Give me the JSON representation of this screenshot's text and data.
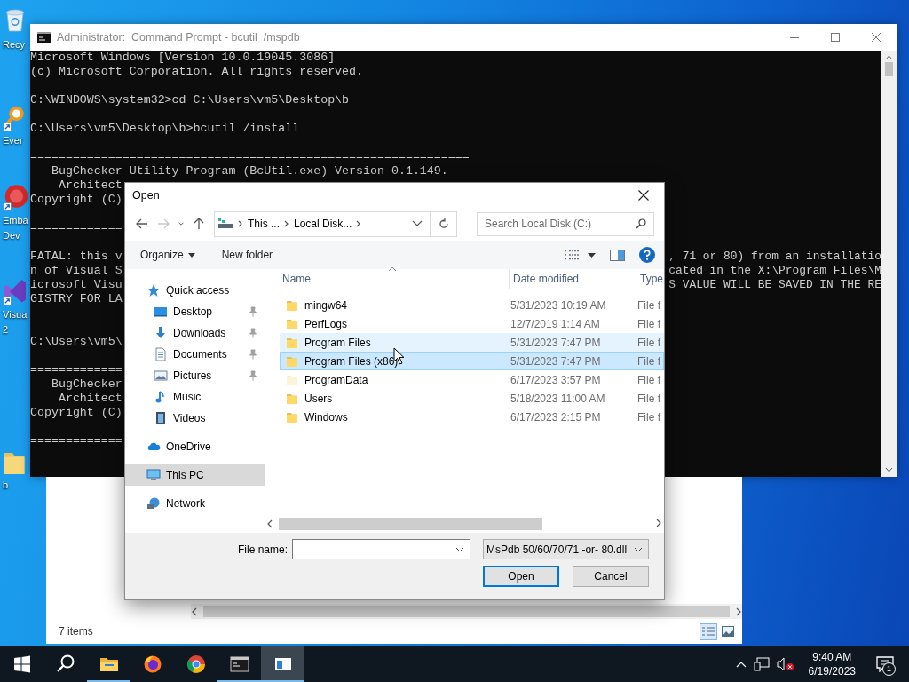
{
  "desktop_icons": [
    {
      "kind": "bin",
      "shortcut": false,
      "label_lines": [
        "Recy"
      ]
    },
    {
      "kind": "search",
      "shortcut": true,
      "label_lines": [
        "Ever"
      ]
    },
    {
      "kind": "embarcadero",
      "shortcut": true,
      "label_lines": [
        "Emba",
        "Dev"
      ]
    },
    {
      "kind": "studio",
      "shortcut": true,
      "label_lines": [
        "Visua",
        "2"
      ]
    },
    {
      "kind": "folder",
      "shortcut": false,
      "label_lines": [
        "b"
      ]
    }
  ],
  "console": {
    "title": "Administrator:  Command Prompt - bcutil  /mspdb",
    "lines": [
      {
        "kind": "text",
        "text": "Microsoft Windows [Version 10.0.19045.3086]"
      },
      {
        "kind": "text",
        "text": "(c) Microsoft Corporation. All rights reserved."
      },
      {
        "kind": "blank"
      },
      {
        "kind": "text",
        "text": "C:\\WINDOWS\\system32>cd C:\\Users\\vm5\\Desktop\\b"
      },
      {
        "kind": "blank"
      },
      {
        "kind": "text",
        "text": "C:\\Users\\vm5\\Desktop\\b>bcutil /install"
      },
      {
        "kind": "blank"
      },
      {
        "kind": "text",
        "text": "=============================================================="
      },
      {
        "kind": "text",
        "text": "   BugChecker Utility Program (BcUtil.exe) Version 0.1.149."
      },
      {
        "kind": "text",
        "text": "    Architect"
      },
      {
        "kind": "text",
        "text": "Copyright (C)"
      },
      {
        "kind": "blank"
      },
      {
        "kind": "text",
        "text": "============="
      },
      {
        "kind": "blank"
      },
      {
        "kind": "text",
        "text": "FATAL: this v",
        "tail": ", 71 or 80) from an installatio"
      },
      {
        "kind": "text",
        "text": "n of Visual S",
        "tail": "cated in the X:\\Program Files\\M"
      },
      {
        "kind": "text",
        "text": "icrosoft Visu",
        "tail": "S VALUE WILL BE SAVED IN THE RE"
      },
      {
        "kind": "text",
        "text": "GISTRY FOR LA"
      },
      {
        "kind": "blank"
      },
      {
        "kind": "blank"
      },
      {
        "kind": "text",
        "text": "C:\\Users\\vm5\\"
      },
      {
        "kind": "blank"
      },
      {
        "kind": "text",
        "text": "============="
      },
      {
        "kind": "text",
        "text": "   BugChecker"
      },
      {
        "kind": "text",
        "text": "    Architect"
      },
      {
        "kind": "text",
        "text": "Copyright (C)"
      },
      {
        "kind": "blank"
      },
      {
        "kind": "text",
        "text": "============="
      }
    ]
  },
  "explorer": {
    "status": "7 items"
  },
  "dialog": {
    "title": "Open",
    "breadcrumb": [
      "This ...",
      "Local Disk..."
    ],
    "search": {
      "placeholder": "Search Local Disk (C:)"
    },
    "toolbar": {
      "organize": "Organize",
      "new_folder": "New folder"
    },
    "nav": [
      {
        "kind": "star",
        "label": "Quick access",
        "pinned": false,
        "selected": false,
        "children": [
          {
            "kind": "desktop",
            "label": "Desktop",
            "pinned": true,
            "selected": false
          },
          {
            "kind": "download",
            "label": "Downloads",
            "pinned": true,
            "selected": false
          },
          {
            "kind": "documents",
            "label": "Documents",
            "pinned": true,
            "selected": false
          },
          {
            "kind": "pictures",
            "label": "Pictures",
            "pinned": true,
            "selected": false
          },
          {
            "kind": "music",
            "label": "Music",
            "pinned": false,
            "selected": false
          },
          {
            "kind": "videos",
            "label": "Videos",
            "pinned": false,
            "selected": false
          }
        ]
      },
      {
        "kind": "cloud",
        "label": "OneDrive",
        "pinned": false,
        "selected": false
      },
      {
        "kind": "pc",
        "label": "This PC",
        "pinned": false,
        "selected": true
      },
      {
        "kind": "network",
        "label": "Network",
        "pinned": false,
        "selected": false
      }
    ],
    "columns": [
      "Name",
      "Date modified",
      "Type"
    ],
    "rows": [
      {
        "name": "mingw64",
        "date": "5/31/2023 10:19 AM",
        "type": "File f",
        "hidden": false,
        "hovered": false,
        "selected": false
      },
      {
        "name": "PerfLogs",
        "date": "12/7/2019 1:14 AM",
        "type": "File f",
        "hidden": false,
        "hovered": false,
        "selected": false
      },
      {
        "name": "Program Files",
        "date": "5/31/2023 7:47 PM",
        "type": "File f",
        "hidden": false,
        "hovered": true,
        "selected": false
      },
      {
        "name": "Program Files (x86)",
        "date": "5/31/2023 7:47 PM",
        "type": "File f",
        "hidden": false,
        "hovered": false,
        "selected": true
      },
      {
        "name": "ProgramData",
        "date": "6/17/2023 3:57 PM",
        "type": "File f",
        "hidden": true,
        "hovered": false,
        "selected": false
      },
      {
        "name": "Users",
        "date": "5/18/2023 11:00 AM",
        "type": "File f",
        "hidden": false,
        "hovered": false,
        "selected": false
      },
      {
        "name": "Windows",
        "date": "6/17/2023 2:15 PM",
        "type": "File f",
        "hidden": false,
        "hovered": false,
        "selected": false
      }
    ],
    "file_name": {
      "label": "File name:"
    },
    "filter": "MsPdb 50/60/70/71 -or- 80.dll",
    "buttons": [
      {
        "label": "Open",
        "default": true
      },
      {
        "label": "Cancel",
        "default": false
      }
    ]
  },
  "taskbar": {
    "items": [
      {
        "kind": "start",
        "running": false,
        "active": false
      },
      {
        "kind": "search",
        "running": false,
        "active": false
      },
      {
        "kind": "explorer",
        "running": true,
        "active": false
      },
      {
        "kind": "firefox",
        "running": false,
        "active": false
      },
      {
        "kind": "chrome",
        "running": false,
        "active": false
      },
      {
        "kind": "console",
        "running": true,
        "active": false
      },
      {
        "kind": "app",
        "running": true,
        "active": true
      }
    ],
    "time": "9:40 AM",
    "date": "6/19/2023",
    "notifications": "1"
  }
}
